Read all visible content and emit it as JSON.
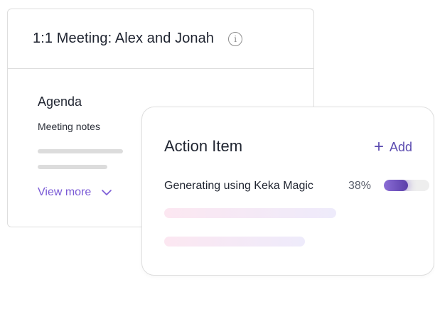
{
  "meeting_card": {
    "title": "1:1 Meeting: Alex and Jonah",
    "info_icon": "info-icon",
    "agenda_heading": "Agenda",
    "notes_label": "Meeting notes",
    "view_more_label": "View more",
    "chevron_icon": "chevron-down-icon"
  },
  "action_card": {
    "title": "Action Item",
    "add_label": "Add",
    "add_icon": "plus-icon",
    "generating_label": "Generating using Keka Magic",
    "progress_text": "38%",
    "progress_value": 0.38
  },
  "colors": {
    "accent": "#7a5ad6",
    "add_text": "#5b4bb0",
    "progress_start": "#8b6dd6",
    "progress_end": "#5a3ea8"
  }
}
